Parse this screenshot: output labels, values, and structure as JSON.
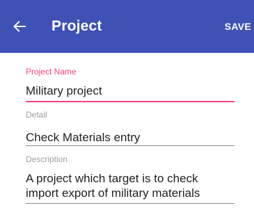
{
  "toolbar": {
    "title": "Project",
    "save_label": "SAVE",
    "back_icon": "arrow-back-icon",
    "background_color": "#3f51b5"
  },
  "form": {
    "project_name": {
      "label": "Project Name",
      "value": "Military project",
      "focused": true,
      "accent_color": "#ff4081"
    },
    "detail": {
      "label": "Detail",
      "value": "Check Materials entry"
    },
    "description": {
      "label": "Description",
      "value_line1": "A project which target is to check",
      "value_line2": "import export of military materials"
    }
  }
}
